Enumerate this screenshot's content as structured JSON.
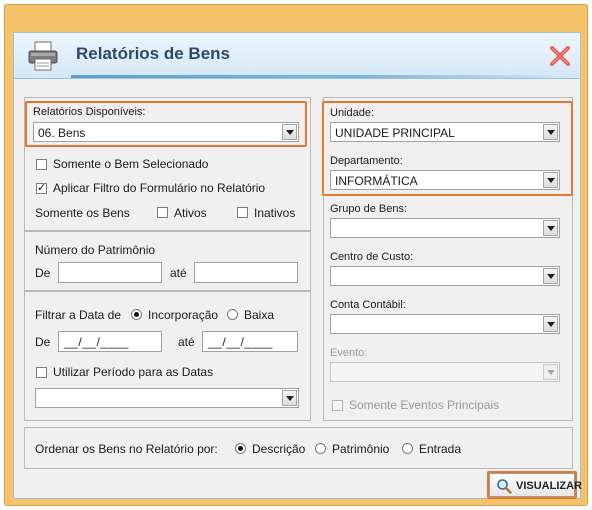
{
  "window": {
    "title": "Relatórios de Bens",
    "icons": {
      "printer": "printer-icon",
      "close": "close-icon",
      "magnifier": "magnifier-icon"
    },
    "accent_color": "#e7762b"
  },
  "left": {
    "relatorios_label": "Relatórios Disponíveis:",
    "relatorios_value": "06. Bens",
    "somente_bem_selecionado": {
      "label": "Somente o Bem Selecionado",
      "checked": false
    },
    "aplicar_filtro": {
      "label": "Aplicar Filtro do Formulário no Relatório",
      "checked": true
    },
    "somente_os_bens_label": "Somente os Bens",
    "ativos": {
      "label": "Ativos",
      "checked": false
    },
    "inativos": {
      "label": "Inativos",
      "checked": false
    },
    "patrimonio": {
      "label": "Número do Patrimônio",
      "de_label": "De",
      "ate_label": "até",
      "de_value": "",
      "ate_value": ""
    },
    "filtrar_data": {
      "label": "Filtrar a Data de",
      "opt_incorporacao": "Incorporação",
      "opt_baixa": "Baixa",
      "selected": "Incorporação",
      "de_label": "De",
      "ate_label": "até",
      "de_value": "__/__/____",
      "ate_value": "__/__/____"
    },
    "utilizar_periodo": {
      "label": "Utilizar Período para as Datas",
      "checked": false
    },
    "periodo_value": ""
  },
  "right": {
    "unidade_label": "Unidade:",
    "unidade_value": "UNIDADE PRINCIPAL",
    "departamento_label": "Departamento:",
    "departamento_value": "INFORMÁTICA",
    "grupo_label": "Grupo de Bens:",
    "grupo_value": "",
    "centro_label": "Centro de Custo:",
    "centro_value": "",
    "conta_label": "Conta Contábil:",
    "conta_value": "",
    "evento_label": "Evento:",
    "evento_value": "",
    "somente_eventos": {
      "label": "Somente Eventos Principais",
      "checked": false
    }
  },
  "ordenar": {
    "label": "Ordenar os Bens no Relatório por:",
    "opt_descricao": "Descrição",
    "opt_patrimonio": "Patrimônio",
    "opt_entrada": "Entrada",
    "selected": "Descrição"
  },
  "visualizar_label": "VISUALIZAR"
}
